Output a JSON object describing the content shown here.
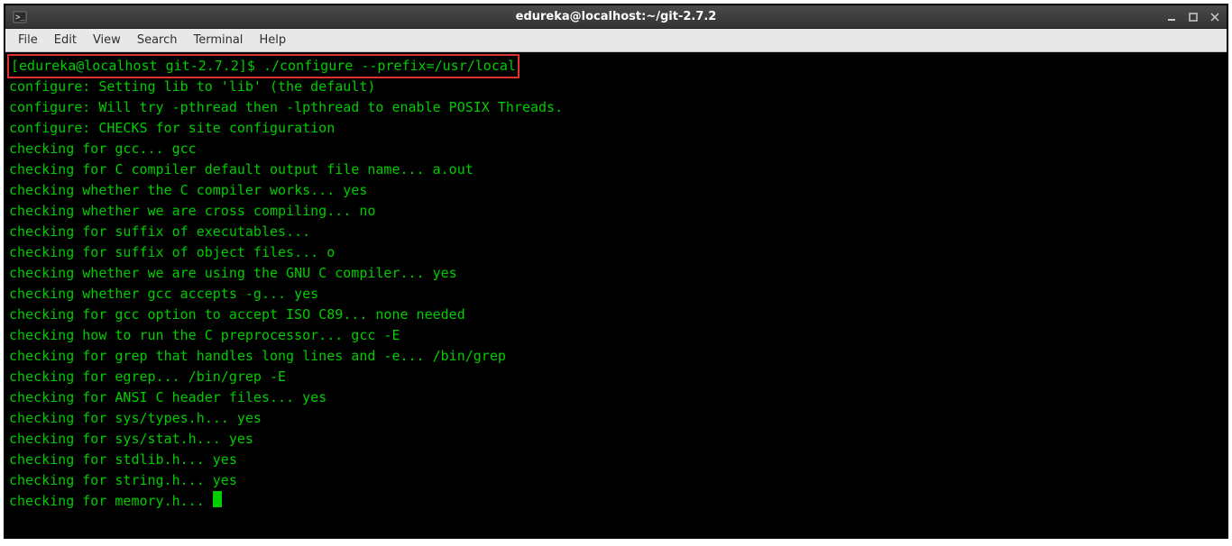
{
  "window": {
    "title": "edureka@localhost:~/git-2.7.2"
  },
  "menubar": {
    "items": [
      "File",
      "Edit",
      "View",
      "Search",
      "Terminal",
      "Help"
    ]
  },
  "terminal": {
    "prompt": "[edureka@localhost git-2.7.2]$ ",
    "command": "./configure --prefix=/usr/local",
    "output_lines": [
      "configure: Setting lib to 'lib' (the default)",
      "configure: Will try -pthread then -lpthread to enable POSIX Threads.",
      "configure: CHECKS for site configuration",
      "checking for gcc... gcc",
      "checking for C compiler default output file name... a.out",
      "checking whether the C compiler works... yes",
      "checking whether we are cross compiling... no",
      "checking for suffix of executables... ",
      "checking for suffix of object files... o",
      "checking whether we are using the GNU C compiler... yes",
      "checking whether gcc accepts -g... yes",
      "checking for gcc option to accept ISO C89... none needed",
      "checking how to run the C preprocessor... gcc -E",
      "checking for grep that handles long lines and -e... /bin/grep",
      "checking for egrep... /bin/grep -E",
      "checking for ANSI C header files... yes",
      "checking for sys/types.h... yes",
      "checking for sys/stat.h... yes",
      "checking for stdlib.h... yes",
      "checking for string.h... yes",
      "checking for memory.h... "
    ]
  }
}
